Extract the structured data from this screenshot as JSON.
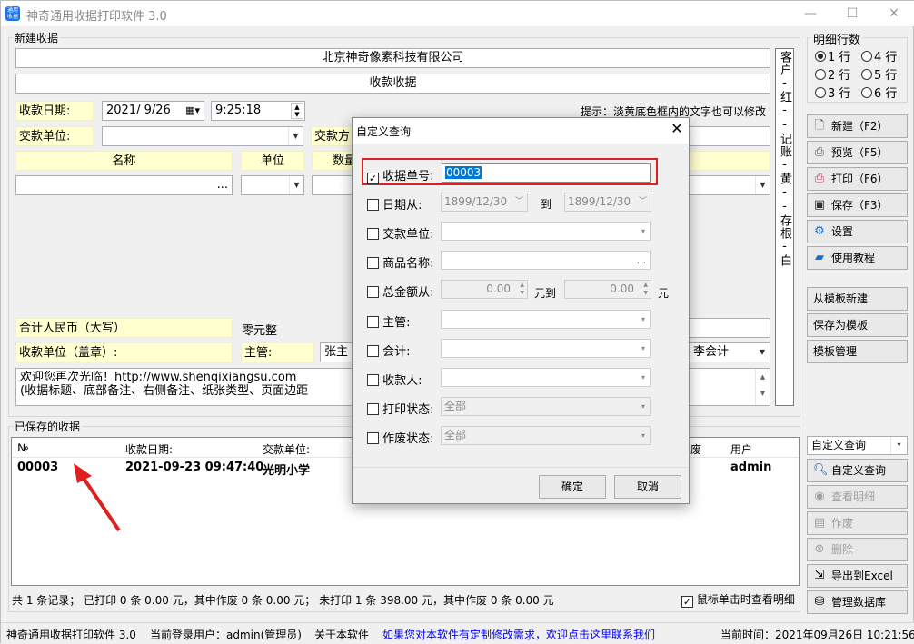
{
  "window": {
    "title": "神奇通用收据打印软件 3.0",
    "icon_text": "通用\n收据"
  },
  "new_receipt": {
    "group_label": "新建收据",
    "company": "北京神奇像素科技有限公司",
    "receipt_title": "收款收据",
    "date_label": "收款日期:",
    "date_value": "2021/ 9/26",
    "time_value": "9:25:18",
    "hint": "提示：淡黄底色框内的文字也可以修改",
    "payer_label": "交款单位:",
    "payer_method_label": "交款方",
    "col_name": "名称",
    "col_unit": "单位",
    "col_qty": "数量",
    "total_cn_label": "合计人民币（大写）",
    "total_cn_value": "零元整",
    "payee_label": "收款单位（盖章）:",
    "manager_label": "主管:",
    "manager_value": "张主",
    "accountant_value": "李会计",
    "note_line1": "欢迎您再次光临！http://www.shenqixiangsu.com",
    "note_line2": "(收据标题、底部备注、右侧备注、纸张类型、页面边距",
    "side_note": "客户-红--记账-黄--存根-白"
  },
  "detail_rows": {
    "label": "明细行数",
    "options": [
      "1 行",
      "4 行",
      "2 行",
      "5 行",
      "3 行",
      "6 行"
    ],
    "selected": "1 行"
  },
  "actions": {
    "new": "新建（F2）",
    "preview": "预览（F5）",
    "print": "打印（F6）",
    "save": "保存（F3）",
    "settings": "设置",
    "tutorial": "使用教程",
    "from_template": "从模板新建",
    "save_template": "保存为模板",
    "manage_template": "模板管理"
  },
  "saved": {
    "group_label": "已保存的收据",
    "headers": [
      "№",
      "收款日期:",
      "交款单位:",
      "废",
      "用户"
    ],
    "rows": [
      {
        "no": "00003",
        "date": "2021-09-23 09:47:40",
        "payer": "光明小学",
        "user": "admin"
      }
    ],
    "summary": "共 1 条记录；   已打印 0 条 0.00 元，其中作废 0 条 0.00 元；   未打印 1 条 398.00 元，其中作废 0 条 0.00 元",
    "click_detail_label": "鼠标单击时查看明细",
    "click_detail_checked": true
  },
  "query_panel": {
    "select_value": "自定义查询",
    "custom_query": "自定义查询",
    "view_detail": "查看明细",
    "void": "作废",
    "delete": "删除",
    "export_excel": "导出到Excel",
    "manage_db": "管理数据库"
  },
  "dialog": {
    "title": "自定义查询",
    "receipt_no_label": "收据单号:",
    "receipt_no_value": "00003",
    "date_from_label": "日期从:",
    "date_from_value": "1899/12/30",
    "to_label": "到",
    "date_to_value": "1899/12/30",
    "payer_label": "交款单位:",
    "product_label": "商品名称:",
    "amount_label": "总金额从:",
    "amount_from": "0.00",
    "yuan_to": "元到",
    "amount_to": "0.00",
    "yuan": "元",
    "manager_label": "主管:",
    "accountant_label": "会计:",
    "payee_label": "收款人:",
    "print_status_label": "打印状态:",
    "print_status_value": "全部",
    "void_status_label": "作废状态:",
    "void_status_value": "全部",
    "ok": "确定",
    "cancel": "取消"
  },
  "status": {
    "app": "神奇通用收据打印软件 3.0",
    "user": "当前登录用户：admin(管理员)",
    "about": "关于本软件",
    "contact": "如果您对本软件有定制修改需求，欢迎点击这里联系我们",
    "time": "当前时间：2021年09月26日  10:21:56"
  },
  "colors": {
    "yellow_field": "#ffffd0",
    "link_blue": "#0000ff",
    "highlight_red": "#e02020",
    "selection_blue": "#0078d7"
  }
}
